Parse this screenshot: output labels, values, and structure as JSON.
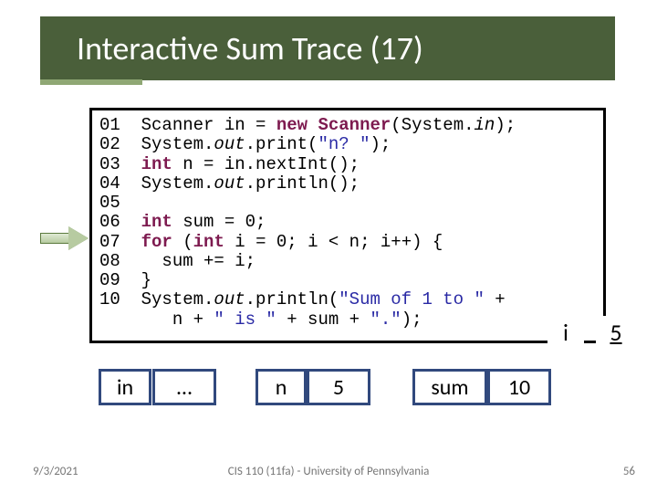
{
  "title": "Interactive Sum Trace (17)",
  "code_html": "01  Scanner in = <span class='kw'>new</span> <span class='kw'>Scanner</span>(System.<span class='it'>in</span>);\n02  System.<span class='it'>out</span>.print(<span class='str'>\"n? \"</span>);\n03  <span class='kw'>int</span> n = in.nextInt();\n04  System.<span class='it'>out</span>.println();\n05\n06  <span class='kw'>int</span> sum = 0;\n07  <span class='kw'>for</span> (<span class='kw'>int</span> i = 0; i &lt; n; i++) {\n08    sum += i;\n09  }\n10  System.<span class='it'>out</span>.println(<span class='str'>\"Sum of 1 to \"</span> +\n       n + <span class='str'>\" is \"</span> + sum + <span class='str'>\".\"</span>);",
  "vars": {
    "i_label": "i",
    "i_value": "5",
    "in_label": "in",
    "in_value": "…",
    "n_label": "n",
    "n_value": "5",
    "sum_label": "sum",
    "sum_value": "10"
  },
  "footer": {
    "left": "9/3/2021",
    "center": "CIS 110 (11fa) - University of Pennsylvania",
    "right": "56"
  }
}
